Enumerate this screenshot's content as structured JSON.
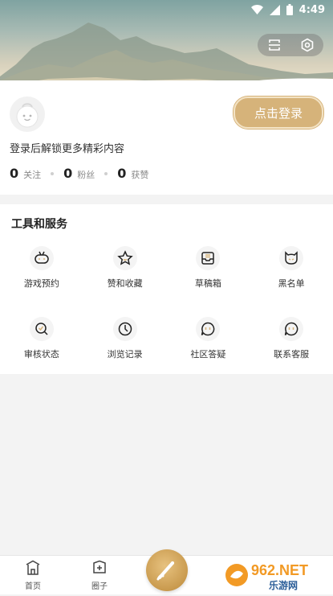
{
  "status_bar": {
    "time": "4:49"
  },
  "profile": {
    "login_button": "点击登录",
    "login_tip": "登录后解锁更多精彩内容",
    "stats": [
      {
        "value": "0",
        "label": "关注"
      },
      {
        "value": "0",
        "label": "粉丝"
      },
      {
        "value": "0",
        "label": "获赞"
      }
    ]
  },
  "tools": {
    "title": "工具和服务",
    "items": [
      {
        "label": "游戏预约",
        "icon": "gamepad-icon"
      },
      {
        "label": "赞和收藏",
        "icon": "star-icon"
      },
      {
        "label": "草稿箱",
        "icon": "drafts-tray-icon"
      },
      {
        "label": "黑名单",
        "icon": "blacklist-cat-icon"
      },
      {
        "label": "审核状态",
        "icon": "review-status-icon"
      },
      {
        "label": "浏览记录",
        "icon": "clock-icon"
      },
      {
        "label": "社区答疑",
        "icon": "chat-question-icon"
      },
      {
        "label": "联系客服",
        "icon": "customer-service-icon"
      }
    ]
  },
  "bottom_nav": {
    "items": [
      {
        "label": "首页",
        "icon": "home-pavilion-icon"
      },
      {
        "label": "圈子",
        "icon": "circle-plus-icon"
      }
    ]
  },
  "watermark": {
    "text": "962.NET",
    "subtext": "乐游网"
  },
  "colors": {
    "accent": "#d6b37a",
    "background": "#f3f3f3"
  }
}
